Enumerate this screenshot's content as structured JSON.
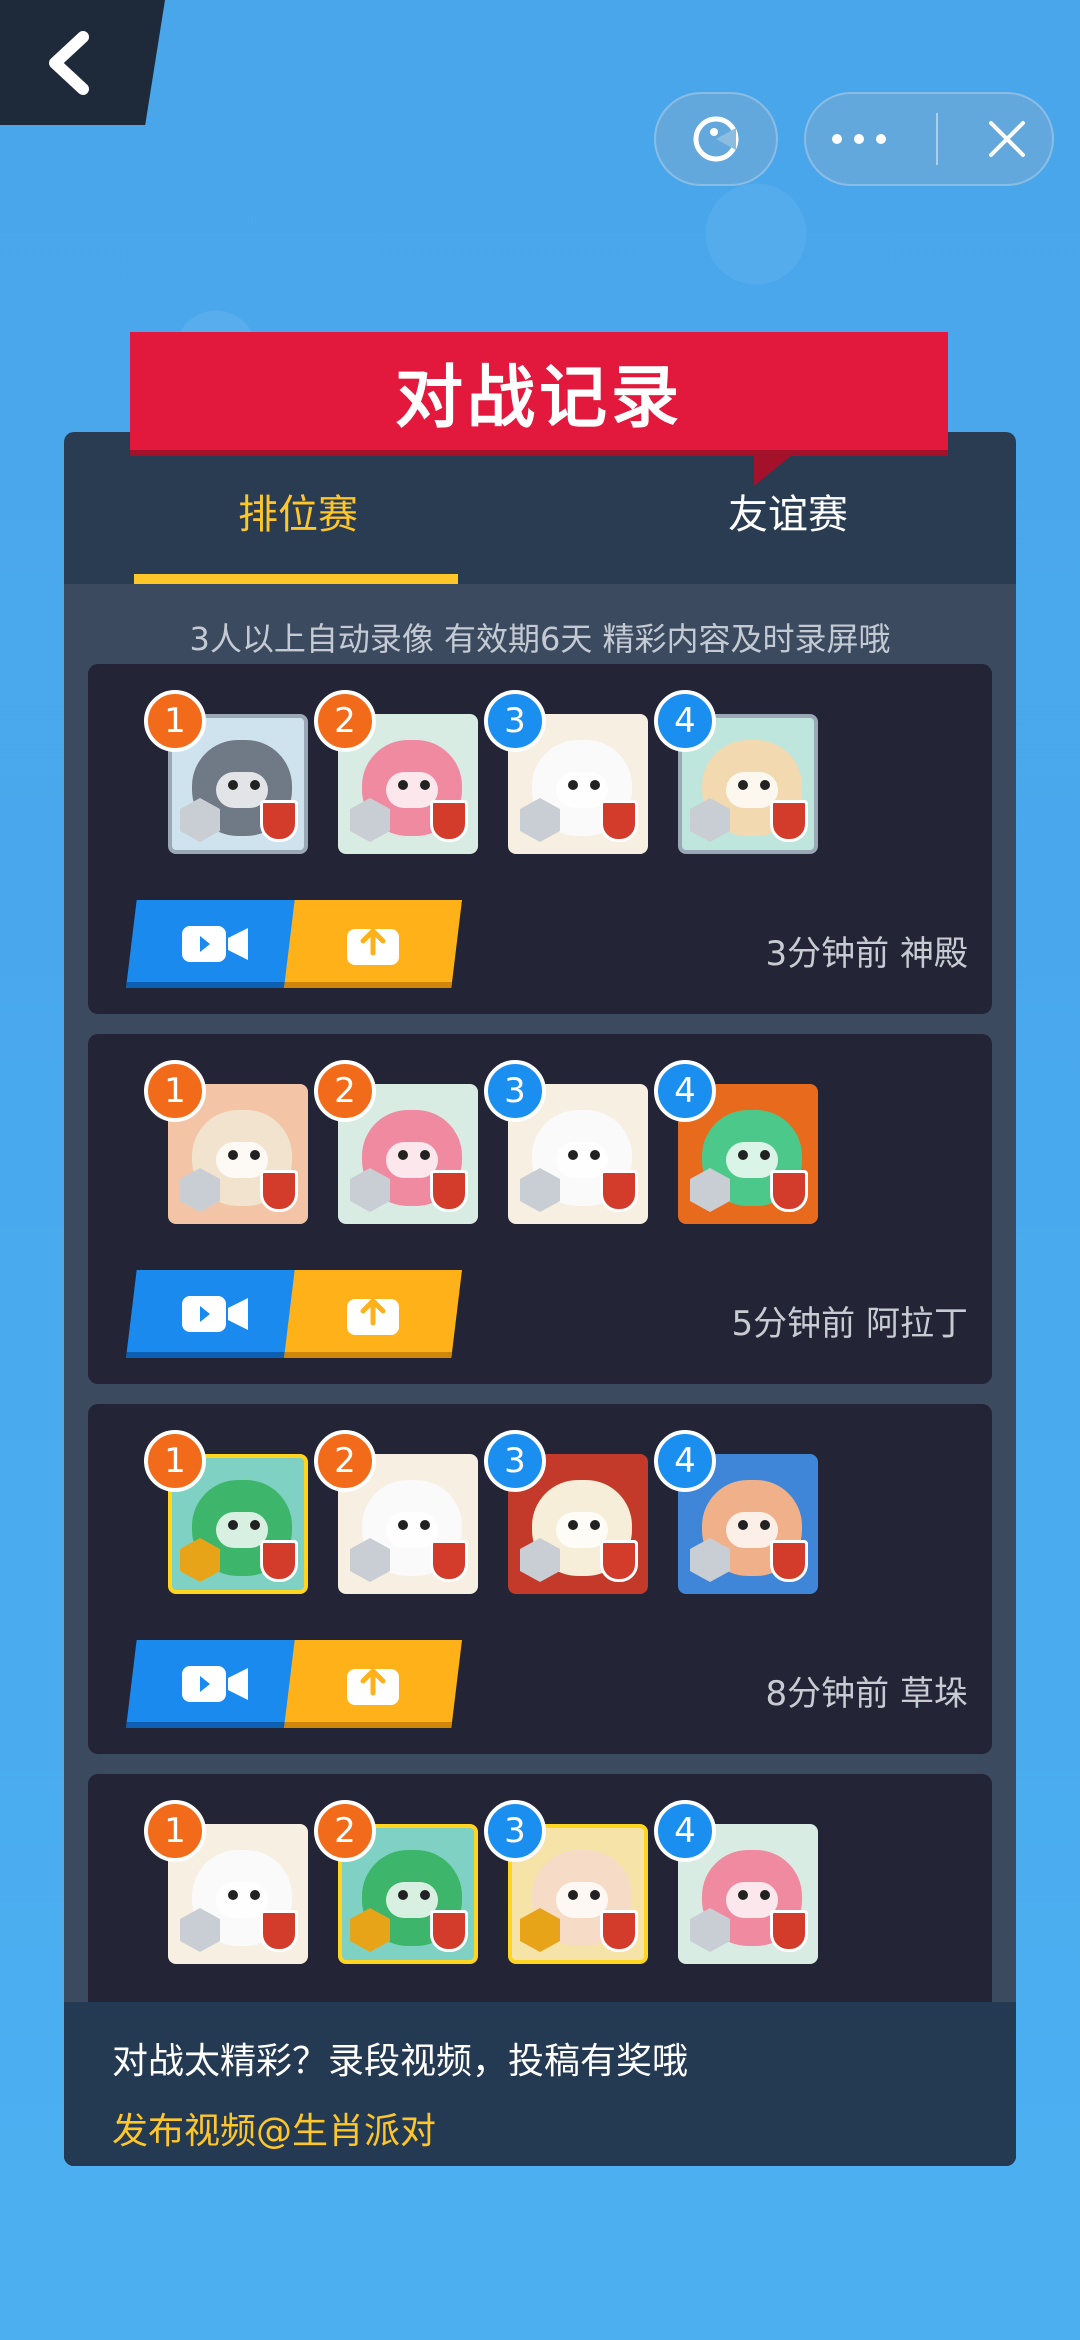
{
  "header": {
    "title": "对战记录"
  },
  "tabs": {
    "ranked": "排位赛",
    "friendly": "友谊赛"
  },
  "notice": "3人以上自动录像 有效期6天 精彩内容及时录屏哦",
  "colors": {
    "background": "#4aa8ec",
    "panel": "#2a3c52",
    "card": "#232536",
    "accent_yellow": "#ffc62a",
    "banner_red": "#e3183d",
    "video_blue": "#1b8aee",
    "share_orange": "#ffb11a"
  },
  "icons": {
    "back": "back-chevron-icon",
    "game": "pacman-icon",
    "more": "more-dots-icon",
    "close": "close-x-icon",
    "video": "video-camera-icon",
    "share": "upload-share-icon"
  },
  "records": [
    {
      "meta": "3分钟前 神殿",
      "players": [
        {
          "rank": "1",
          "avatar": "raccoon"
        },
        {
          "rank": "2",
          "avatar": "pink-helmet"
        },
        {
          "rank": "3",
          "avatar": "white-sheep"
        },
        {
          "rank": "4",
          "avatar": "cream-sheep"
        }
      ]
    },
    {
      "meta": "5分钟前 阿拉丁",
      "players": [
        {
          "rank": "1",
          "avatar": "sheep-red-hat"
        },
        {
          "rank": "2",
          "avatar": "pink-helmet"
        },
        {
          "rank": "3",
          "avatar": "white-sheep"
        },
        {
          "rank": "4",
          "avatar": "pumpkin-dino"
        }
      ]
    },
    {
      "meta": "8分钟前 草垛",
      "players": [
        {
          "rank": "1",
          "avatar": "green-dino"
        },
        {
          "rank": "2",
          "avatar": "white-sheep"
        },
        {
          "rank": "3",
          "avatar": "ox-red"
        },
        {
          "rank": "4",
          "avatar": "lion-girl"
        }
      ]
    },
    {
      "meta": "",
      "players": [
        {
          "rank": "1",
          "avatar": "white-sheep"
        },
        {
          "rank": "2",
          "avatar": "green-dino"
        },
        {
          "rank": "3",
          "avatar": "cream-pig"
        },
        {
          "rank": "4",
          "avatar": "pink-helmet"
        }
      ]
    }
  ],
  "bottom": {
    "text": "对战太精彩？录段视频，投稿有奖哦",
    "link": "发布视频@生肖派对"
  }
}
